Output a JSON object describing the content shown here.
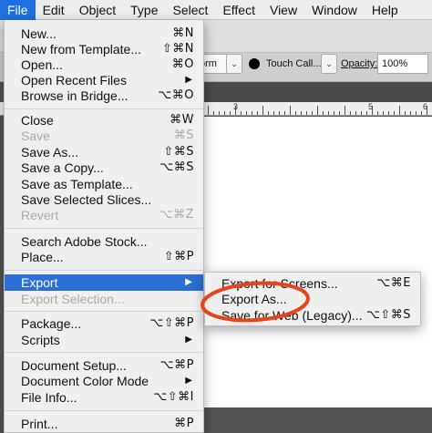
{
  "menubar": {
    "items": [
      {
        "label": "File",
        "active": true
      },
      {
        "label": "Edit",
        "active": false
      },
      {
        "label": "Object",
        "active": false
      },
      {
        "label": "Type",
        "active": false
      },
      {
        "label": "Select",
        "active": false
      },
      {
        "label": "Effect",
        "active": false
      },
      {
        "label": "View",
        "active": false
      },
      {
        "label": "Window",
        "active": false
      },
      {
        "label": "Help",
        "active": false
      }
    ]
  },
  "control_bar": {
    "stroke_option": "orm",
    "brush_name": "Touch Call...",
    "opacity_label": "Opacity:",
    "opacity_value": "100%",
    "chevron": "⌄"
  },
  "ruler": {
    "labels": [
      "3",
      "5",
      "6"
    ]
  },
  "file_menu": {
    "items": [
      {
        "label": "New...",
        "shortcut": "⌘N",
        "disabled": false,
        "submenu": false
      },
      {
        "label": "New from Template...",
        "shortcut": "⇧⌘N",
        "disabled": false,
        "submenu": false
      },
      {
        "label": "Open...",
        "shortcut": "⌘O",
        "disabled": false,
        "submenu": false
      },
      {
        "label": "Open Recent Files",
        "shortcut": "",
        "disabled": false,
        "submenu": true
      },
      {
        "label": "Browse in Bridge...",
        "shortcut": "⌥⌘O",
        "disabled": false,
        "submenu": false
      },
      {
        "label": "Close",
        "shortcut": "⌘W",
        "disabled": false,
        "submenu": false
      },
      {
        "label": "Save",
        "shortcut": "⌘S",
        "disabled": true,
        "submenu": false
      },
      {
        "label": "Save As...",
        "shortcut": "⇧⌘S",
        "disabled": false,
        "submenu": false
      },
      {
        "label": "Save a Copy...",
        "shortcut": "⌥⌘S",
        "disabled": false,
        "submenu": false
      },
      {
        "label": "Save as Template...",
        "shortcut": "",
        "disabled": false,
        "submenu": false
      },
      {
        "label": "Save Selected Slices...",
        "shortcut": "",
        "disabled": false,
        "submenu": false
      },
      {
        "label": "Revert",
        "shortcut": "⌥⌘Z",
        "disabled": true,
        "submenu": false
      },
      {
        "label": "Search Adobe Stock...",
        "shortcut": "",
        "disabled": false,
        "submenu": false
      },
      {
        "label": "Place...",
        "shortcut": "⇧⌘P",
        "disabled": false,
        "submenu": false
      },
      {
        "label": "Export",
        "shortcut": "",
        "disabled": false,
        "submenu": true
      },
      {
        "label": "Export Selection...",
        "shortcut": "",
        "disabled": true,
        "submenu": false
      },
      {
        "label": "Package...",
        "shortcut": "⌥⇧⌘P",
        "disabled": false,
        "submenu": false
      },
      {
        "label": "Scripts",
        "shortcut": "",
        "disabled": false,
        "submenu": true
      },
      {
        "label": "Document Setup...",
        "shortcut": "⌥⌘P",
        "disabled": false,
        "submenu": false
      },
      {
        "label": "Document Color Mode",
        "shortcut": "",
        "disabled": false,
        "submenu": true
      },
      {
        "label": "File Info...",
        "shortcut": "⌥⇧⌘I",
        "disabled": false,
        "submenu": false
      },
      {
        "label": "Print...",
        "shortcut": "⌘P",
        "disabled": false,
        "submenu": false
      }
    ],
    "submenu_arrow": "▶"
  },
  "export_submenu": {
    "items": [
      {
        "label": "Export for Screens...",
        "shortcut": "⌥⌘E"
      },
      {
        "label": "Export As...",
        "shortcut": ""
      },
      {
        "label": "Save for Web (Legacy)...",
        "shortcut": "⌥⇧⌘S"
      }
    ]
  },
  "colors": {
    "highlight": "#2a6fd6",
    "annotation": "#e8431d",
    "menu_bg": "#efefef"
  }
}
